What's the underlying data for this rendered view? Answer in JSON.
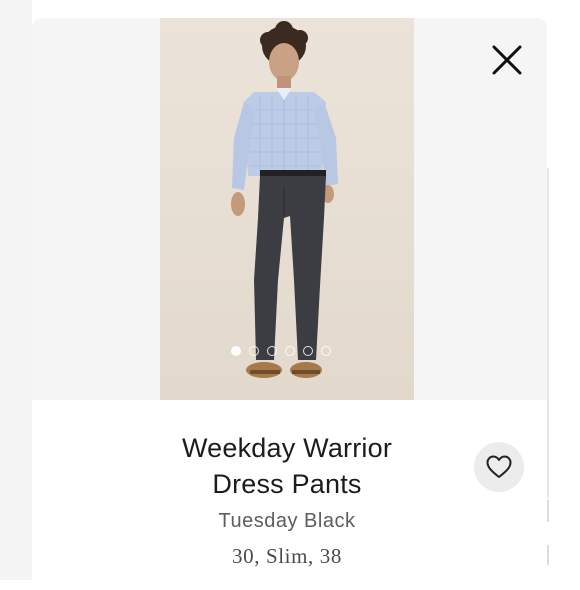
{
  "product": {
    "title_line1": "Weekday Warrior",
    "title_line2": "Dress Pants",
    "color": "Tuesday Black",
    "sizes": "30, Slim, 38"
  },
  "gallery": {
    "image_count": 6,
    "active_index": 0
  },
  "icons": {
    "close": "close-icon",
    "favorite": "heart-outline-icon"
  },
  "colors": {
    "photo_background": "#e8e0d6",
    "favorite_button_bg": "#ececec",
    "title_text": "#1c1c1c"
  }
}
